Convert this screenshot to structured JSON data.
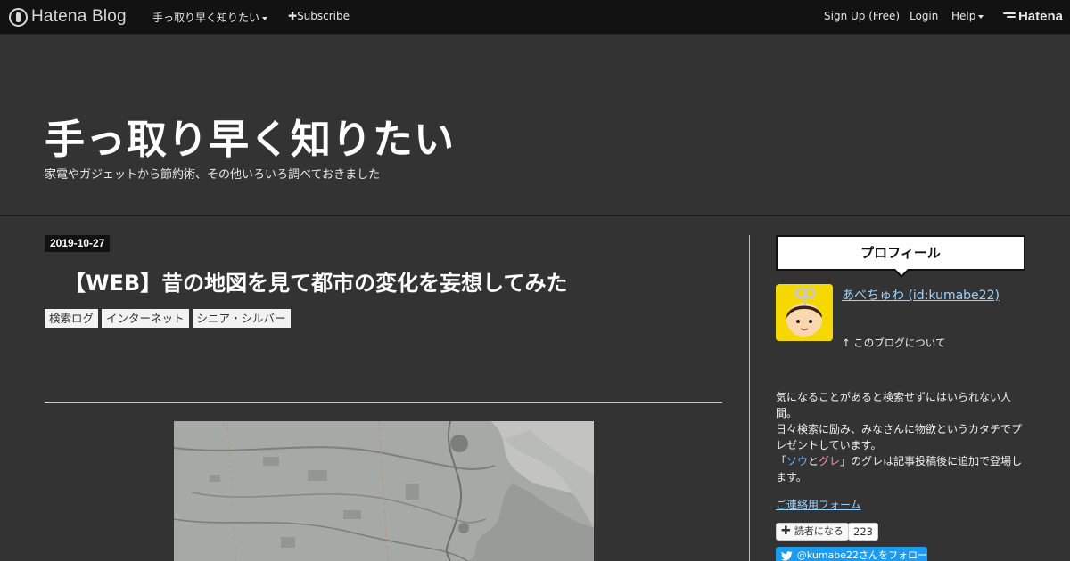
{
  "topbar": {
    "logo_text": "Hatena Blog",
    "blog_menu_label": "手っ取り早く知りたい",
    "subscribe_label": "Subscribe",
    "signup_label": "Sign Up (Free)",
    "login_label": "Login",
    "help_label": "Help",
    "brand_label": "Hatena"
  },
  "header": {
    "title": "手っ取り早く知りたい",
    "description": "家電やガジェットから節約術、その他いろいろ調べておきました"
  },
  "entry": {
    "date": "2019-10-27",
    "title": "【WEB】昔の地図を見て都市の変化を妄想してみた",
    "categories": [
      "検索ログ",
      "インターネット",
      "シニア・シルバー"
    ]
  },
  "sidebar": {
    "profile_heading": "プロフィール",
    "profile_name": "あべちゅわ (id:kumabe22)",
    "about_link": "↑ このブログについて",
    "description_1": "気になることがあると検索せずにはいられない人間。",
    "description_2": "日々検索に励み、みなさんに物欲というカタチでプレゼントしています。",
    "desc_3a": "「",
    "desc_3_sou": "ソウ",
    "desc_3b": "と",
    "desc_3_gure": "グレ",
    "desc_3c": "」のグレは記事投稿後に追加で登場します。",
    "contact_link": "ご連絡用フォーム",
    "reader_button": "読者になる",
    "reader_count": "223",
    "follow_button": "@kumabe22さんをフォロー"
  },
  "colors": {
    "background": "#333333",
    "topbar": "#121212",
    "link": "#9cd4ff",
    "twitter": "#1d9bf0"
  }
}
